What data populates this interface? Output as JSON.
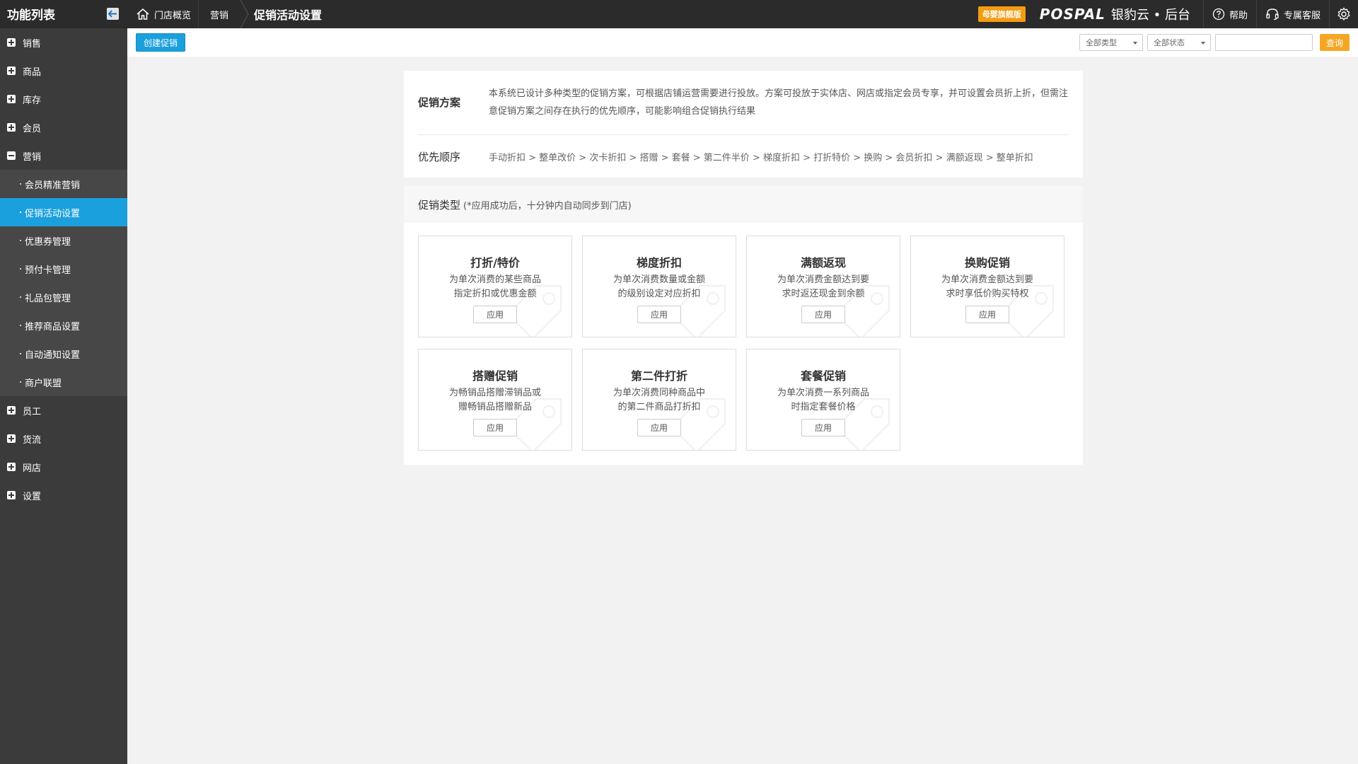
{
  "sidebar": {
    "title": "功能列表",
    "menu": [
      {
        "label": "销售",
        "expanded": false
      },
      {
        "label": "商品",
        "expanded": false
      },
      {
        "label": "库存",
        "expanded": false
      },
      {
        "label": "会员",
        "expanded": false
      },
      {
        "label": "营销",
        "expanded": true
      }
    ],
    "submenu": [
      {
        "label": "会员精准营销",
        "active": false
      },
      {
        "label": "促销活动设置",
        "active": true
      },
      {
        "label": "优惠券管理",
        "active": false
      },
      {
        "label": "预付卡管理",
        "active": false
      },
      {
        "label": "礼品包管理",
        "active": false
      },
      {
        "label": "推荐商品设置",
        "active": false
      },
      {
        "label": "自动通知设置",
        "active": false
      },
      {
        "label": "商户联盟",
        "active": false
      }
    ],
    "menu_after": [
      {
        "label": "员工",
        "expanded": false
      },
      {
        "label": "货流",
        "expanded": false
      },
      {
        "label": "网店",
        "expanded": false
      },
      {
        "label": "设置",
        "expanded": false
      }
    ]
  },
  "topbar": {
    "home_label": "门店概览",
    "crumb": "营销",
    "current": "促销活动设置",
    "badge": "母婴旗舰版",
    "logo_en": "POSPAL",
    "logo_cn": "银豹云 • 后台",
    "help_label": "帮助",
    "service_label": "专属客服"
  },
  "toolbar": {
    "create_label": "创建促销",
    "type_select": "全部类型",
    "status_select": "全部状态",
    "search_value": "",
    "query_label": "查询"
  },
  "scheme": {
    "title": "促销方案",
    "text": "本系统已设计多种类型的促销方案，可根据店铺运营需要进行投放。方案可投放于实体店、网店或指定会员专享，并可设置会员折上折，但需注意促销方案之间存在执行的优先顺序，可能影响组合促销执行结果"
  },
  "priority": {
    "title": "优先顺序",
    "text": "手动折扣 > 整单改价 > 次卡折扣 > 搭赠 > 套餐 > 第二件半价 > 梯度折扣 > 打折特价 > 换购 > 会员折扣 > 满额返现 > 整单折扣"
  },
  "types": {
    "title": "促销类型",
    "note": "(*应用成功后，十分钟内自动同步到门店)",
    "apply_label": "应用",
    "cards": [
      {
        "title": "打折/特价",
        "desc1": "为单次消费的某些商品",
        "desc2": "指定折扣或优惠金额"
      },
      {
        "title": "梯度折扣",
        "desc1": "为单次消费数量或金额",
        "desc2": "的级别设定对应折扣"
      },
      {
        "title": "满额返现",
        "desc1": "为单次消费金额达到要",
        "desc2": "求时返还现金到余额"
      },
      {
        "title": "换购促销",
        "desc1": "为单次消费金额达到要",
        "desc2": "求时享低价购买特权"
      },
      {
        "title": "搭赠促销",
        "desc1": "为畅销品搭赠滞销品或",
        "desc2": "赠畅销品搭赠新品"
      },
      {
        "title": "第二件打折",
        "desc1": "为单次消费同种商品中",
        "desc2": "的第二件商品打折扣"
      },
      {
        "title": "套餐促销",
        "desc1": "为单次消费一系列商品",
        "desc2": "时指定套餐价格"
      }
    ]
  },
  "colors": {
    "accent": "#1aa0dc",
    "query": "#f5a623",
    "badge": "#f39c12",
    "sidebar": "#3b3b3b",
    "topbar": "#2b2b2b"
  }
}
